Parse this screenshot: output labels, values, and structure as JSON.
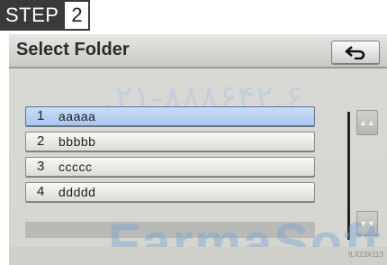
{
  "step": {
    "word": "STEP",
    "number": "2"
  },
  "header": {
    "title": "Select Folder",
    "back_icon": "back-arrow-icon"
  },
  "watermark_top": ".۲۱-۸۸۸۶۴۲.۶",
  "watermark_bottom": "FarmaSoft",
  "folders": [
    {
      "num": "1",
      "name": "aaaaa",
      "selected": true
    },
    {
      "num": "2",
      "name": "bbbbb",
      "selected": false
    },
    {
      "num": "3",
      "name": "ccccc",
      "selected": false
    },
    {
      "num": "4",
      "name": "ddddd",
      "selected": false
    }
  ],
  "scroll": {
    "up_icon": "scroll-up-icon",
    "down_icon": "scroll-down-icon"
  },
  "image_code": "ILX23X113"
}
